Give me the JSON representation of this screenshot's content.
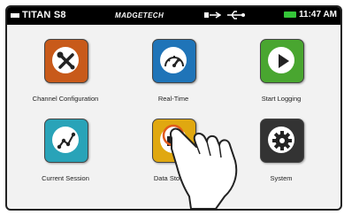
{
  "status_bar": {
    "device_name": "TITAN S8",
    "brand": "MADGETECH",
    "time": "11:47 AM",
    "icons": [
      "usb-icon",
      "usb-plug-icon",
      "battery-icon"
    ]
  },
  "apps": [
    {
      "label": "Channel Configuration",
      "color": "#c85a1a",
      "icon": "wrench-screwdriver-icon"
    },
    {
      "label": "Real-Time",
      "color": "#1f74b8",
      "icon": "gauge-icon"
    },
    {
      "label": "Start Logging",
      "color": "#49a630",
      "icon": "play-icon"
    },
    {
      "label": "Current Session",
      "color": "#29a3b8",
      "icon": "line-graph-icon"
    },
    {
      "label": "Data Storage",
      "color": "#e0a810",
      "icon": "folder-icon"
    },
    {
      "label": "System",
      "color": "#333333",
      "icon": "gear-icon"
    }
  ]
}
